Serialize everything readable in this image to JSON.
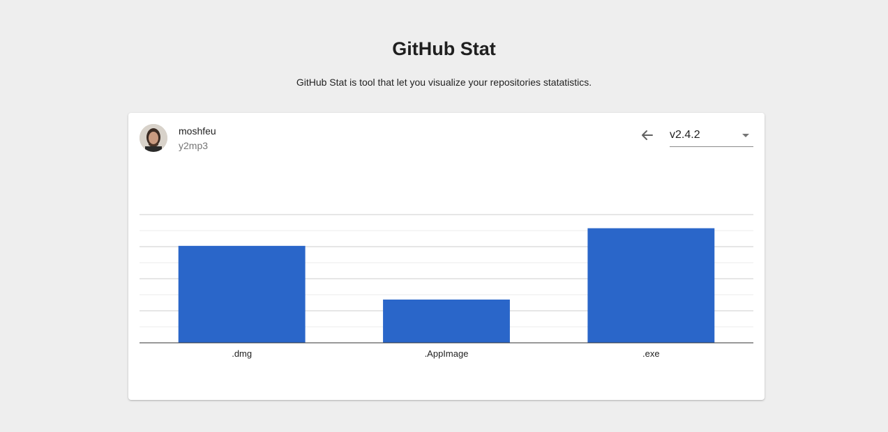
{
  "header": {
    "title": "GitHub Stat",
    "subtitle": "GitHub Stat is tool that let you visualize your repositories statatistics."
  },
  "card": {
    "owner": "moshfeu",
    "repo": "y2mp3",
    "back_icon": "arrow-left-icon",
    "version_selected": "v2.4.2"
  },
  "colors": {
    "bar": "#2a66c9",
    "background": "#eeeeee"
  },
  "chart_data": {
    "type": "bar",
    "categories": [
      ".dmg",
      ".AppImage",
      ".exe"
    ],
    "values": [
      6050,
      2700,
      7150
    ],
    "ylim": [
      0,
      8000
    ],
    "grid": true,
    "legend": "none"
  }
}
